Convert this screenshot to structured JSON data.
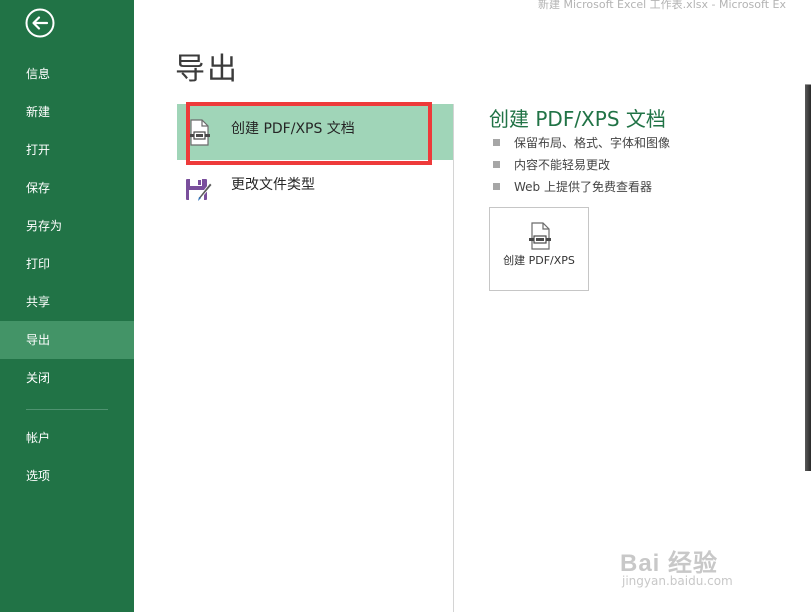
{
  "window": {
    "title": "新建 Microsoft Excel 工作表.xlsx - Microsoft Ex"
  },
  "colors": {
    "sidebar_bg": "#217346",
    "sidebar_active": "#439467",
    "selected_option": "#a0d5b8",
    "accent_title": "#217346",
    "highlight_border": "#ee3a3a"
  },
  "sidebar": {
    "back_icon": "back-arrow-icon",
    "items": [
      {
        "label": "信息"
      },
      {
        "label": "新建"
      },
      {
        "label": "打开"
      },
      {
        "label": "保存"
      },
      {
        "label": "另存为"
      },
      {
        "label": "打印"
      },
      {
        "label": "共享"
      },
      {
        "label": "导出",
        "active": true
      },
      {
        "label": "关闭"
      },
      {
        "label": "帐户"
      },
      {
        "label": "选项"
      }
    ]
  },
  "main": {
    "page_title": "导出",
    "options": [
      {
        "label": "创建 PDF/XPS 文档",
        "icon": "pdf-document-icon",
        "selected": true
      },
      {
        "label": "更改文件类型",
        "icon": "save-as-file-type-icon",
        "selected": false
      }
    ],
    "detail": {
      "title": "创建 PDF/XPS 文档",
      "bullets": [
        "保留布局、格式、字体和图像",
        "内容不能轻易更改",
        "Web 上提供了免费查看器"
      ],
      "button_label": "创建 PDF/XPS",
      "button_icon": "pdf-document-icon"
    }
  },
  "watermark": {
    "main": "Bai 经验",
    "sub": "jingyan.baidu.com"
  }
}
